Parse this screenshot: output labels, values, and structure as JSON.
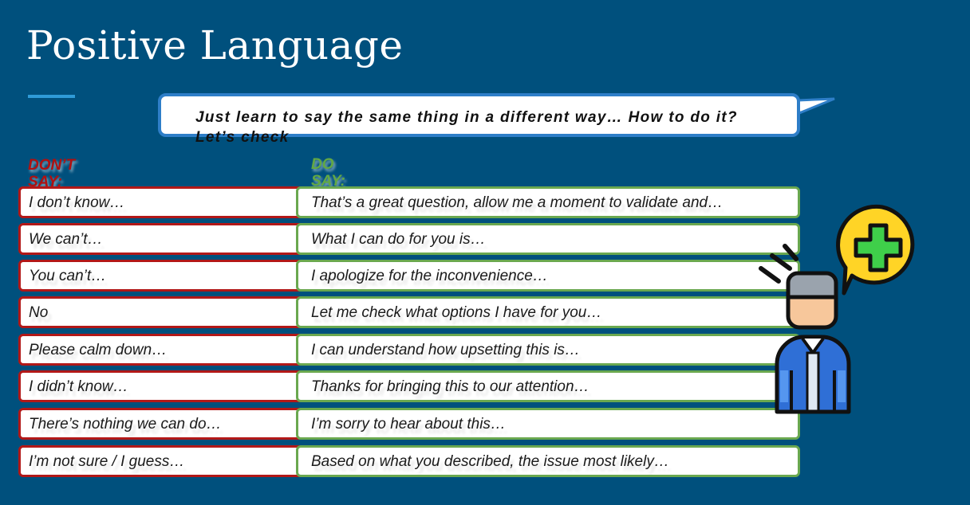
{
  "title": "Positive Language",
  "bubble": {
    "text": "Just learn to say the same thing in a different way… How to do it? Let’s check"
  },
  "headers": {
    "dont": "DON’T SAY:",
    "do": "DO SAY:"
  },
  "rows": [
    {
      "dont": "I don’t know…",
      "do": "That’s a great question, allow me a moment to validate and…"
    },
    {
      "dont": "We can’t…",
      "do": "What I can do for you is…"
    },
    {
      "dont": "You can’t…",
      "do": "I apologize for the inconvenience…"
    },
    {
      "dont": "No",
      "do": "Let me check what options I have for you…"
    },
    {
      "dont": "Please calm down…",
      "do": "I can understand how upsetting this is…"
    },
    {
      "dont": "I didn’t know…",
      "do": "Thanks for bringing this to our attention…"
    },
    {
      "dont": "There’s nothing we can do…",
      "do": "I’m sorry to hear about this…"
    },
    {
      "dont": "I’m not sure / I guess…",
      "do": "Based on what you described, the issue most likely…"
    }
  ],
  "icons": {
    "illustration": "person-with-plus-speech-bubble-icon"
  },
  "colors": {
    "background": "#00507d",
    "dont_border": "#b21818",
    "do_border": "#6aa84f",
    "accent": "#2f9bd8"
  }
}
